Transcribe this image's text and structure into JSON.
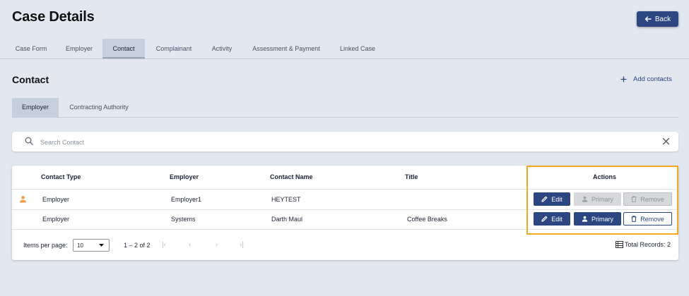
{
  "header": {
    "title": "Case Details",
    "back_label": "Back"
  },
  "main_tabs": [
    {
      "label": "Case Form"
    },
    {
      "label": "Employer"
    },
    {
      "label": "Contact"
    },
    {
      "label": "Complainant"
    },
    {
      "label": "Activity"
    },
    {
      "label": "Assessment & Payment"
    },
    {
      "label": "Linked Case"
    }
  ],
  "section": {
    "title": "Contact",
    "add_label": "Add contacts"
  },
  "sub_tabs": [
    {
      "label": "Employer"
    },
    {
      "label": "Contracting Authority"
    }
  ],
  "search": {
    "placeholder": "Search Contact",
    "value": ""
  },
  "table": {
    "columns": [
      "Contact Type",
      "Employer",
      "Contact Name",
      "Title",
      "Actions"
    ],
    "rows": [
      {
        "contact_type": "Employer",
        "employer": "Employer1",
        "contact_name": "HEYTEST",
        "title": "",
        "is_primary": true
      },
      {
        "contact_type": "Employer",
        "employer": "Systems",
        "contact_name": "Darth Maul",
        "title": "Coffee Breaks",
        "is_primary": false
      }
    ],
    "actions": {
      "edit": "Edit",
      "primary": "Primary",
      "remove": "Remove"
    }
  },
  "pagination": {
    "items_per_page_label": "Items per page:",
    "items_per_page": "10",
    "range": "1 – 2 of 2",
    "total_label": "Total Records: 2"
  },
  "colors": {
    "accent": "#2c4682",
    "highlight": "#f5a623",
    "primary_person_icon": "#f0a050"
  }
}
